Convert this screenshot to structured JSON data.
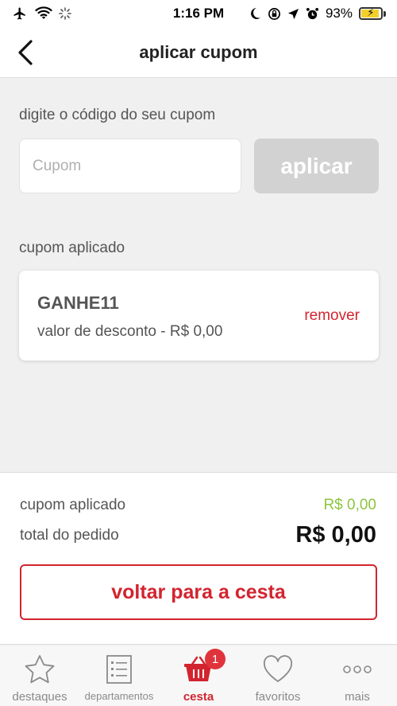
{
  "status_bar": {
    "time": "1:16 PM",
    "battery_percent": "93%",
    "battery_level": 0.93
  },
  "header": {
    "title": "aplicar cupom"
  },
  "coupon_entry": {
    "label": "digite o código do seu cupom",
    "placeholder": "Cupom",
    "value": "",
    "apply_label": "aplicar"
  },
  "applied_coupon": {
    "section_label": "cupom aplicado",
    "code": "GANHE11",
    "discount_text": "valor de desconto - R$ 0,00",
    "remove_label": "remover"
  },
  "summary": {
    "coupon_label": "cupom aplicado",
    "coupon_value": "R$ 0,00",
    "total_label": "total do pedido",
    "total_value": "R$ 0,00",
    "back_button_label": "voltar para a cesta"
  },
  "tabbar": {
    "items": [
      {
        "label": "destaques",
        "icon": "star-icon"
      },
      {
        "label": "departamentos",
        "icon": "list-icon"
      },
      {
        "label": "cesta",
        "icon": "basket-icon",
        "badge": "1",
        "active": true
      },
      {
        "label": "favoritos",
        "icon": "heart-icon"
      },
      {
        "label": "mais",
        "icon": "more-icon"
      }
    ]
  },
  "colors": {
    "accent_red": "#d2242f",
    "coupon_green": "#8cc63f",
    "disabled_gray": "#d2d2d2"
  }
}
